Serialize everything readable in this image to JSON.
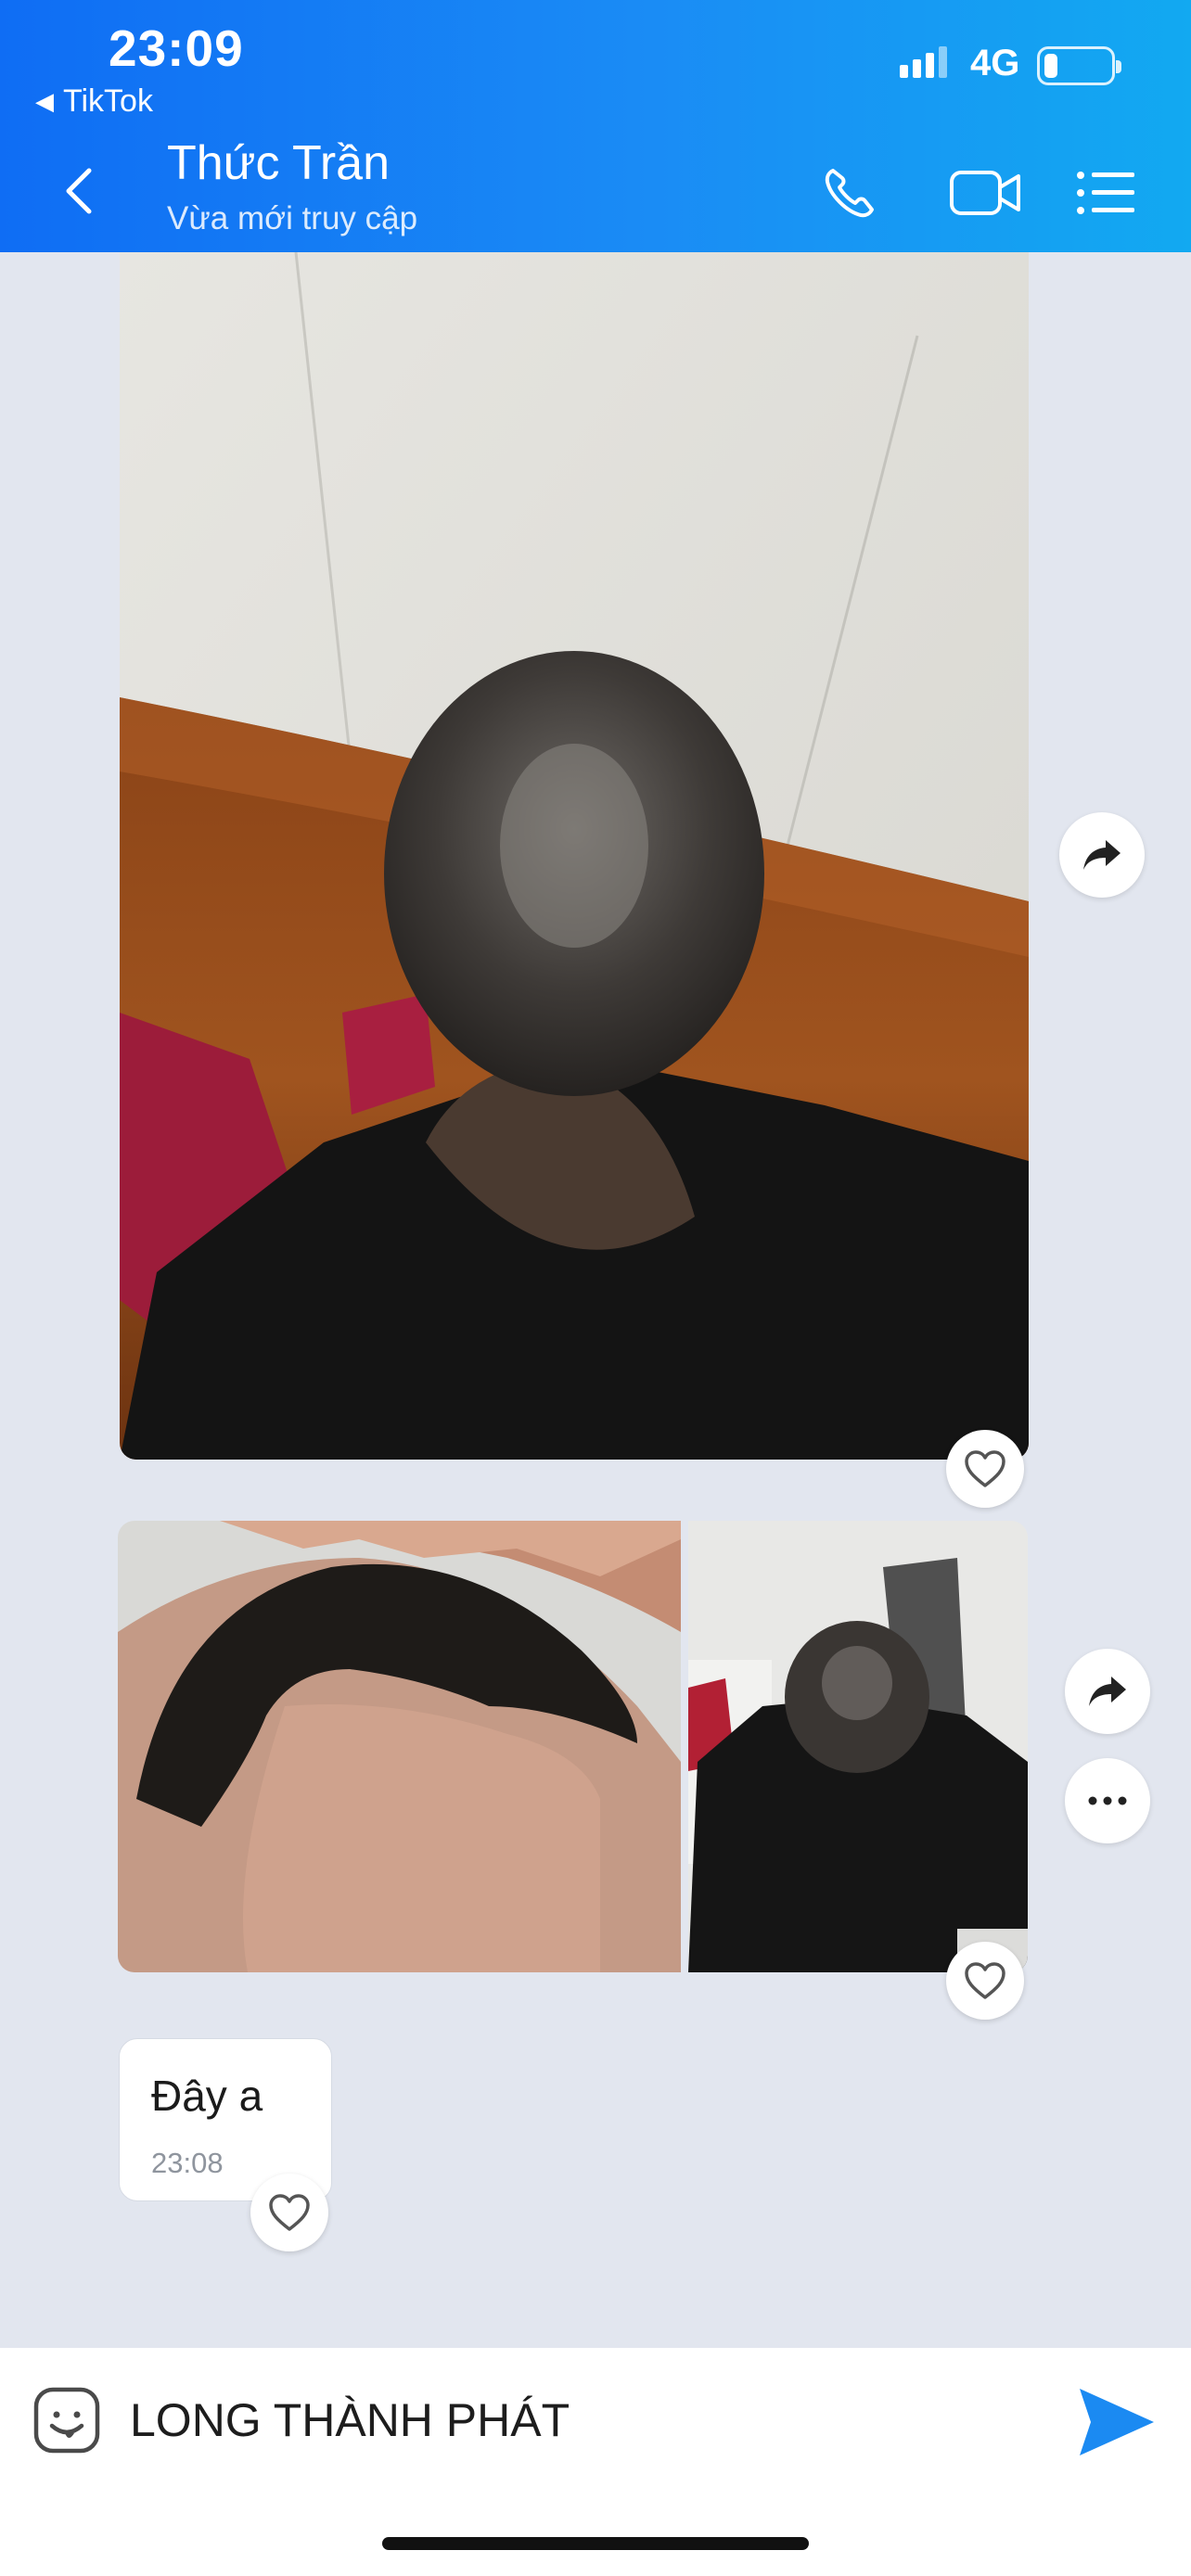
{
  "status_bar": {
    "time": "23:09",
    "back_app": "TikTok",
    "network": "4G"
  },
  "header": {
    "contact_name": "Thức Trần",
    "status": "Vừa mới truy cập",
    "icons": [
      "back-icon",
      "phone-icon",
      "video-call-icon",
      "menu-icon"
    ]
  },
  "messages": [
    {
      "type": "image",
      "description_icon": "photo"
    },
    {
      "type": "image-group",
      "count": 2
    },
    {
      "type": "text",
      "text": "Đây a",
      "time": "23:08"
    }
  ],
  "composer": {
    "input_value": "LONG THÀNH PHÁT",
    "icons": [
      "emoji-icon",
      "send-icon"
    ]
  },
  "colors": {
    "header_start": "#0f6df4",
    "header_end": "#12a9f1",
    "background": "#e2e6ef",
    "send": "#1b8af2"
  }
}
